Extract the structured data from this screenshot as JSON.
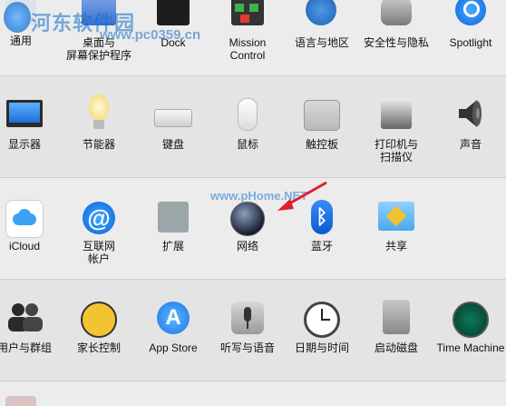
{
  "watermark": {
    "main": "河东软件园",
    "url": "www.pc0359.cn",
    "mid": "www.pHome.NET"
  },
  "row1": [
    {
      "label": "通用",
      "icon": "general-icon"
    },
    {
      "label1": "桌面与",
      "label2": "屏幕保护程序",
      "icon": "desktop-screensaver-icon"
    },
    {
      "label": "Dock",
      "icon": "dock-icon"
    },
    {
      "label1": "Mission",
      "label2": "Control",
      "icon": "mission-control-icon"
    },
    {
      "label": "语言与地区",
      "icon": "language-region-icon"
    },
    {
      "label": "安全性与隐私",
      "icon": "security-privacy-icon"
    },
    {
      "label": "Spotlight",
      "icon": "spotlight-icon"
    }
  ],
  "row2": [
    {
      "label": "显示器",
      "icon": "displays-icon"
    },
    {
      "label": "节能器",
      "icon": "energy-saver-icon"
    },
    {
      "label": "键盘",
      "icon": "keyboard-icon"
    },
    {
      "label": "鼠标",
      "icon": "mouse-icon"
    },
    {
      "label": "触控板",
      "icon": "trackpad-icon"
    },
    {
      "label1": "打印机与",
      "label2": "扫描仪",
      "icon": "printers-scanners-icon"
    },
    {
      "label": "声音",
      "icon": "sound-icon"
    }
  ],
  "row3": [
    {
      "label": "iCloud",
      "icon": "icloud-icon"
    },
    {
      "label1": "互联网",
      "label2": "帐户",
      "icon": "internet-accounts-icon"
    },
    {
      "label": "扩展",
      "icon": "extensions-icon"
    },
    {
      "label": "网络",
      "icon": "network-icon"
    },
    {
      "label": "蓝牙",
      "icon": "bluetooth-icon"
    },
    {
      "label": "共享",
      "icon": "sharing-icon"
    }
  ],
  "row4": [
    {
      "label": "用户与群组",
      "icon": "users-groups-icon"
    },
    {
      "label": "家长控制",
      "icon": "parental-controls-icon"
    },
    {
      "label": "App Store",
      "icon": "app-store-icon"
    },
    {
      "label": "听写与语音",
      "icon": "dictation-speech-icon"
    },
    {
      "label": "日期与时间",
      "icon": "date-time-icon"
    },
    {
      "label": "启动磁盘",
      "icon": "startup-disk-icon"
    },
    {
      "label": "Time Machine",
      "icon": "time-machine-icon"
    }
  ],
  "colors": {
    "arrow": "#e0202a",
    "accent": "#1a7ae0"
  }
}
